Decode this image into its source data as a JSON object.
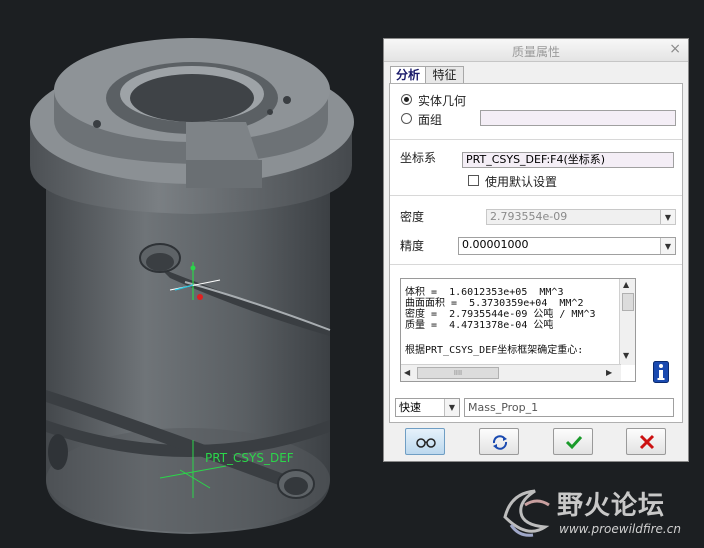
{
  "viewport": {
    "csys_label": "PRT_CSYS_DEF"
  },
  "dialog": {
    "title": "质量属性",
    "close_glyph": "×",
    "tabs": [
      {
        "label": "分析",
        "active": true
      },
      {
        "label": "特征",
        "active": false
      }
    ],
    "geometry_options": [
      {
        "label": "实体几何",
        "selected": true
      },
      {
        "label": "面组",
        "selected": false
      }
    ],
    "quilt_value": "",
    "csys": {
      "label": "坐标系",
      "value": "PRT_CSYS_DEF:F4(坐标系)",
      "default_checkbox_label": "使用默认设置",
      "default_checked": false
    },
    "density": {
      "label": "密度",
      "value": "2.793554e-09"
    },
    "accuracy": {
      "label": "精度",
      "value": "0.00001000"
    },
    "results_lines": [
      "体积 =  1.6012353e+05  MM^3",
      "曲面面积 =  5.3730359e+04  MM^2",
      "密度 =  2.7935544e-09 公吨 / MM^3",
      "质量 =  4.4731378e-04 公吨",
      "",
      "根据PRT_CSYS_DEF坐标框架确定重心:"
    ],
    "results_hscroll_label": "IIII",
    "mode": {
      "value": "快速"
    },
    "name_field": "Mass_Prop_1",
    "info_icon": "info-icon",
    "buttons": [
      {
        "name": "preview-button",
        "icon": "glasses-icon"
      },
      {
        "name": "repeat-button",
        "icon": "repeat-icon"
      },
      {
        "name": "ok-button",
        "icon": "checkmark-icon",
        "color": "#1a9a2a"
      },
      {
        "name": "cancel-button",
        "icon": "x-icon",
        "color": "#cc1111"
      }
    ]
  },
  "watermark": {
    "text": "野火论坛",
    "url": "www.proewildfire.cn"
  },
  "colors": {
    "background": "#1c1f22",
    "model": "#6a6f73",
    "dialog_bg": "#f0f0f0",
    "active_tab_text": "#1a1a6a",
    "ok_green": "#1a9a2a",
    "cancel_red": "#cc1111",
    "info_blue": "#1a4ab0"
  }
}
